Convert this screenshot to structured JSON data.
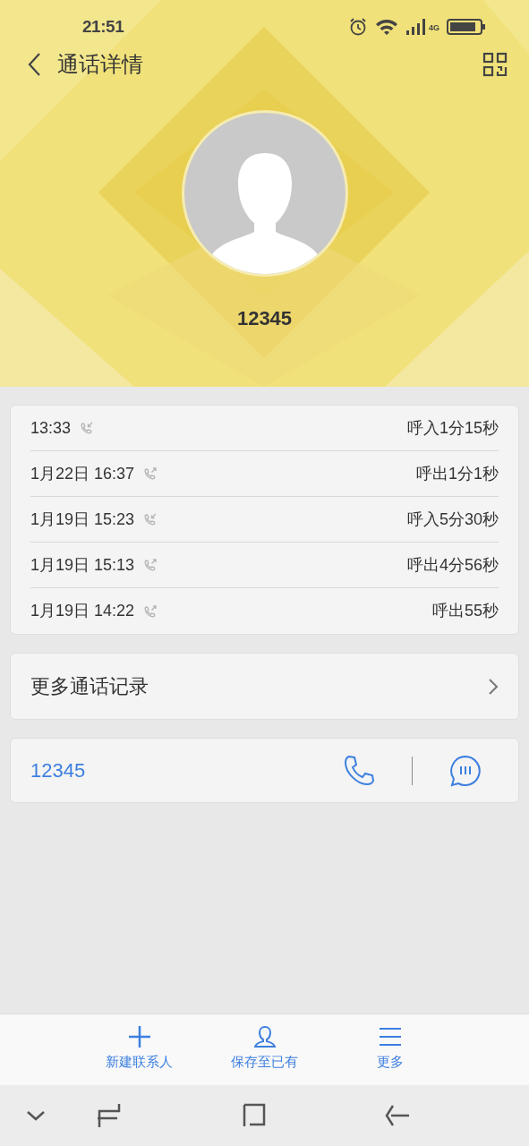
{
  "status_bar": {
    "time": "21:51",
    "network": "4G"
  },
  "header": {
    "title": "通话详情",
    "number": "12345"
  },
  "calls": [
    {
      "time": "13:33",
      "kind": "incoming",
      "summary": "呼入1分15秒"
    },
    {
      "time": "1月22日 16:37",
      "kind": "outgoing",
      "summary": "呼出1分1秒"
    },
    {
      "time": "1月19日 15:23",
      "kind": "incoming",
      "summary": "呼入5分30秒"
    },
    {
      "time": "1月19日 15:13",
      "kind": "outgoing",
      "summary": "呼出4分56秒"
    },
    {
      "time": "1月19日 14:22",
      "kind": "outgoing",
      "summary": "呼出55秒"
    }
  ],
  "more_records": {
    "label": "更多通话记录"
  },
  "contact": {
    "number": "12345"
  },
  "actions": [
    {
      "kind": "add",
      "label": "新建联系人"
    },
    {
      "kind": "person",
      "label": "保存至已有"
    },
    {
      "kind": "menu",
      "label": "更多"
    }
  ]
}
